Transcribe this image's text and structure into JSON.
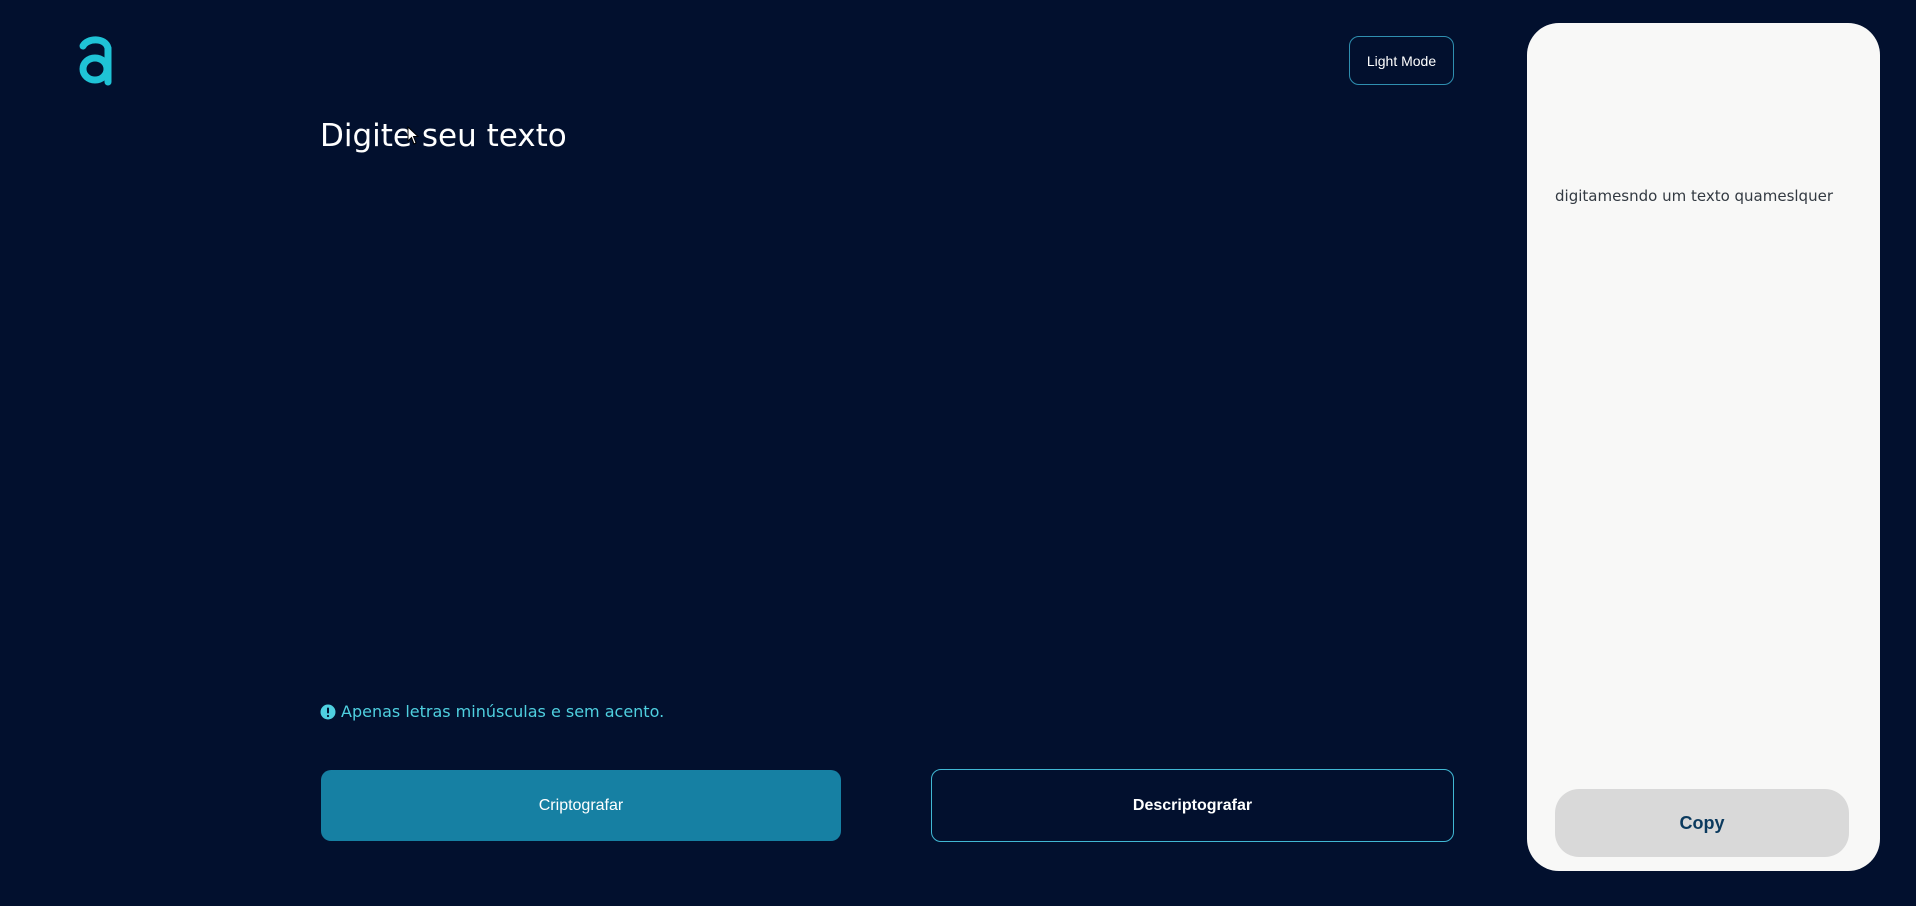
{
  "header": {
    "logo_icon": "letter-a-logo-icon",
    "theme_toggle_label": "Light Mode"
  },
  "input": {
    "placeholder": "Digite seu texto",
    "value": ""
  },
  "hint": {
    "icon": "exclamation-circle-icon",
    "text": "Apenas letras minúsculas e sem acento."
  },
  "actions": {
    "encrypt_label": "Criptografar",
    "decrypt_label": "Descriptografar"
  },
  "output": {
    "text": "digitamesndo um texto quameslquer",
    "copy_label": "Copy"
  },
  "colors": {
    "background": "#02102e",
    "accent": "#1680a3",
    "accent_light": "#4fd0e0",
    "panel": "#f8f8f7",
    "copy_button": "#d9d9d9",
    "copy_text": "#0b3a5e"
  }
}
